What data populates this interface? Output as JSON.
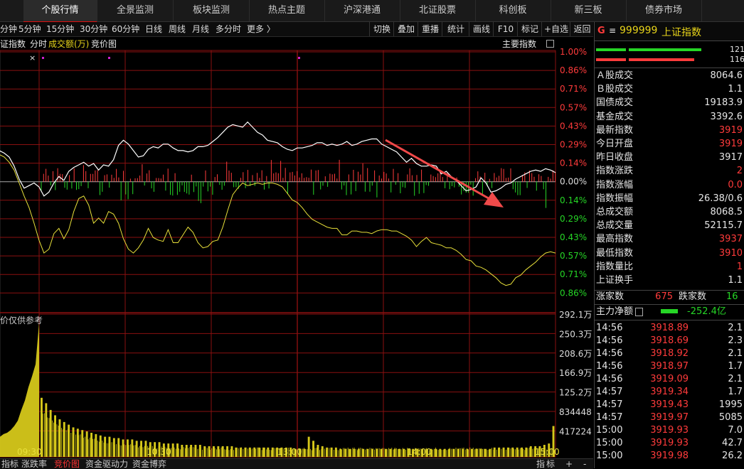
{
  "top_tabs": [
    "个股行情",
    "全景监测",
    "板块监测",
    "热点主题",
    "沪深港通",
    "北证股票",
    "科创板",
    "新三板",
    "债券市场"
  ],
  "active_tab": "个股行情",
  "periods": [
    "分钟",
    "5分钟",
    "15分钟",
    "30分钟",
    "60分钟",
    "日线",
    "周线",
    "月线",
    "多分时",
    "更多 〉"
  ],
  "tools": [
    "切换",
    "叠加",
    "重播",
    "统计",
    "画线",
    "F10",
    "标记",
    "+自选",
    "返回"
  ],
  "sub": {
    "index_label": "证指数",
    "fenshi": "分时",
    "amount": "成交额(万)",
    "auction": "竞价图",
    "main_index": "主要指数",
    "close_x": "×"
  },
  "pct_labels": [
    "1.00%",
    "0.86%",
    "0.71%",
    "0.57%",
    "0.43%",
    "0.29%",
    "0.14%",
    "0.00%",
    "0.14%",
    "0.29%",
    "0.43%",
    "0.57%",
    "0.71%",
    "0.86%"
  ],
  "vol_labels": [
    "292.1万",
    "250.3万",
    "208.6万",
    "166.9万",
    "125.2万",
    "834448",
    "417224"
  ],
  "vol_note": "价仅供参考",
  "time_labels": [
    "09:30",
    "10:30",
    "13:00",
    "14:00",
    "15:00"
  ],
  "bottom_tabs": [
    "指标",
    "涨跌率",
    "竞价图",
    "资金驱动力",
    "资金博弈"
  ],
  "bottom_right": [
    "指",
    "标",
    "+",
    "-"
  ],
  "right_panel": {
    "header_g": "G",
    "header_menu": "≡",
    "code": "999999",
    "name": "上证指数",
    "bar_nums": [
      "121",
      "116"
    ],
    "rows": [
      {
        "label": "Ａ股成交",
        "value": "8064.6"
      },
      {
        "label": "Ｂ股成交",
        "value": "1.1"
      },
      {
        "label": "国债成交",
        "value": "19183.9"
      },
      {
        "label": "基金成交",
        "value": "3392.6"
      },
      {
        "label": "最新指数",
        "value": "3919"
      },
      {
        "label": "今日开盘",
        "value": "3919"
      },
      {
        "label": "昨日收盘",
        "value": "3917"
      },
      {
        "label": "指数涨跌",
        "value": "2"
      },
      {
        "label": "指数涨幅",
        "value": "0.0"
      },
      {
        "label": "指数振幅",
        "value": "26.38/0.6"
      },
      {
        "label": "总成交额",
        "value": "8068.5"
      },
      {
        "label": "总成交量",
        "value": "52115.7"
      },
      {
        "label": "最高指数",
        "value": "3937"
      },
      {
        "label": "最低指数",
        "value": "3910"
      },
      {
        "label": "指数量比",
        "value": "1"
      },
      {
        "label": "上证换手",
        "value": "1.1"
      }
    ],
    "up_label": "涨家数",
    "up_count": "675",
    "down_label": "跌家数",
    "down_count": "16",
    "net_label": "主力净额",
    "net_value": "-252.4亿",
    "ticks": [
      {
        "time": "14:56",
        "price": "3918.89",
        "vol": "2.1"
      },
      {
        "time": "14:56",
        "price": "3918.69",
        "vol": "2.3"
      },
      {
        "time": "14:56",
        "price": "3918.92",
        "vol": "2.1"
      },
      {
        "time": "14:56",
        "price": "3918.97",
        "vol": "1.7"
      },
      {
        "time": "14:56",
        "price": "3919.09",
        "vol": "2.1"
      },
      {
        "time": "14:57",
        "price": "3919.34",
        "vol": "1.7"
      },
      {
        "time": "14:57",
        "price": "3919.43",
        "vol": "1995"
      },
      {
        "time": "14:57",
        "price": "3919.97",
        "vol": "5085"
      },
      {
        "time": "15:00",
        "price": "3919.93",
        "vol": "7.0"
      },
      {
        "time": "15:00",
        "price": "3919.93",
        "vol": "42.7"
      },
      {
        "time": "15:00",
        "price": "3919.98",
        "vol": "26.2"
      }
    ]
  },
  "colors": {
    "up": "#ff3b3b",
    "down": "#26d626",
    "price_line": "#ffffff",
    "avg_line": "#e8e03a",
    "grid": "#8a1010",
    "volume": "#d6c81a",
    "arrow": "#f04a4a"
  },
  "chart_data": {
    "type": "line",
    "pct_axis": [
      -0.86,
      1.0
    ],
    "series": [
      {
        "pct": [
          0.23,
          0.24,
          0.22,
          0.19,
          0.12,
          0.02,
          -0.05,
          -0.03,
          -0.01,
          -0.04,
          -0.11,
          -0.08,
          -0.01,
          0.04,
          0.01,
          0.08,
          0.11,
          0.13,
          0.15,
          0.12,
          0.14,
          0.09,
          0.13,
          0.12,
          0.17,
          0.28,
          0.32,
          0.29,
          0.24,
          0.19,
          0.2,
          0.25,
          0.27,
          0.26,
          0.29,
          0.29,
          0.26,
          0.24,
          0.24,
          0.23,
          0.24,
          0.27,
          0.27,
          0.28,
          0.31,
          0.34,
          0.38,
          0.42,
          0.44,
          0.43,
          0.42,
          0.46,
          0.42,
          0.38,
          0.36,
          0.32,
          0.31,
          0.3,
          0.27,
          0.25,
          0.24,
          0.26,
          0.26,
          0.27,
          0.28,
          0.3,
          0.3,
          0.28,
          0.29,
          0.28,
          0.29,
          0.31,
          0.28,
          0.29,
          0.31,
          0.32,
          0.33,
          0.33,
          0.29,
          0.27,
          0.25,
          0.23,
          0.19,
          0.15,
          0.18,
          0.14,
          0.12,
          0.12,
          0.13,
          0.12,
          0.06,
          0.08,
          0.04,
          0.01,
          -0.03,
          -0.07,
          -0.06,
          -0.04,
          0.03,
          -0.01,
          -0.08,
          -0.07,
          -0.05,
          -0.02,
          -0.01,
          0.02,
          0.04,
          0.06,
          0.08,
          0.09,
          0.08,
          0.1,
          0.09,
          0.07
        ]
      },
      {
        "pct": [
          0.2,
          0.21,
          0.19,
          0.15,
          0.09,
          -0.01,
          -0.11,
          -0.2,
          -0.32,
          -0.45,
          -0.55,
          -0.52,
          -0.4,
          -0.36,
          -0.44,
          -0.37,
          -0.23,
          -0.13,
          -0.11,
          -0.18,
          -0.32,
          -0.28,
          -0.32,
          -0.23,
          -0.25,
          -0.32,
          -0.44,
          -0.52,
          -0.55,
          -0.51,
          -0.45,
          -0.36,
          -0.43,
          -0.45,
          -0.46,
          -0.37,
          -0.47,
          -0.47,
          -0.41,
          -0.35,
          -0.39,
          -0.47,
          -0.51,
          -0.5,
          -0.46,
          -0.45,
          -0.35,
          -0.22,
          -0.1,
          -0.05,
          -0.01,
          -0.03,
          -0.02,
          -0.01,
          -0.02,
          -0.01,
          -0.01,
          -0.02,
          -0.04,
          -0.09,
          -0.14,
          -0.16,
          -0.2,
          -0.25,
          -0.29,
          -0.31,
          -0.33,
          -0.35,
          -0.36,
          -0.36,
          -0.41,
          -0.41,
          -0.38,
          -0.38,
          -0.39,
          -0.39,
          -0.4,
          -0.38,
          -0.37,
          -0.37,
          -0.38,
          -0.38,
          -0.4,
          -0.42,
          -0.45,
          -0.5,
          -0.46,
          -0.43,
          -0.47,
          -0.48,
          -0.49,
          -0.51,
          -0.51,
          -0.53,
          -0.56,
          -0.6,
          -0.61,
          -0.65,
          -0.66,
          -0.68,
          -0.71,
          -0.74,
          -0.78,
          -0.8,
          -0.79,
          -0.74,
          -0.72,
          -0.68,
          -0.65,
          -0.62,
          -0.58,
          -0.55,
          -0.54,
          -0.55
        ]
      }
    ],
    "volume": [
      0.15,
      0.17,
      0.18,
      0.2,
      0.23,
      0.27,
      0.35,
      0.42,
      0.52,
      0.6,
      0.69,
      1.0,
      0.44,
      0.4,
      0.35,
      0.31,
      0.28,
      0.26,
      0.24,
      0.22,
      0.21,
      0.2,
      0.19,
      0.18,
      0.17,
      0.16,
      0.15,
      0.15,
      0.14,
      0.14,
      0.13,
      0.13,
      0.13,
      0.12,
      0.12,
      0.12,
      0.11,
      0.11,
      0.11,
      0.1,
      0.1,
      0.1,
      0.1,
      0.09,
      0.09,
      0.09,
      0.09,
      0.09,
      0.08,
      0.08,
      0.08,
      0.08,
      0.08,
      0.08,
      0.08,
      0.07,
      0.07,
      0.07,
      0.07,
      0.07,
      0.07,
      0.07,
      0.07,
      0.07,
      0.07,
      0.07,
      0.07,
      0.07,
      0.06,
      0.06,
      0.06,
      0.15,
      0.12,
      0.09,
      0.08,
      0.07,
      0.07,
      0.07,
      0.06,
      0.06,
      0.06,
      0.06,
      0.06,
      0.06,
      0.06,
      0.06,
      0.06,
      0.06,
      0.06,
      0.06,
      0.06,
      0.06,
      0.06,
      0.06,
      0.06,
      0.06,
      0.06,
      0.06,
      0.06,
      0.06,
      0.06,
      0.06,
      0.06,
      0.06,
      0.06,
      0.06,
      0.06,
      0.06,
      0.06,
      0.06,
      0.06,
      0.06,
      0.07,
      0.07,
      0.07,
      0.07,
      0.07,
      0.07,
      0.07,
      0.07,
      0.08,
      0.08,
      0.08,
      0.09,
      0.1,
      0.23
    ]
  }
}
